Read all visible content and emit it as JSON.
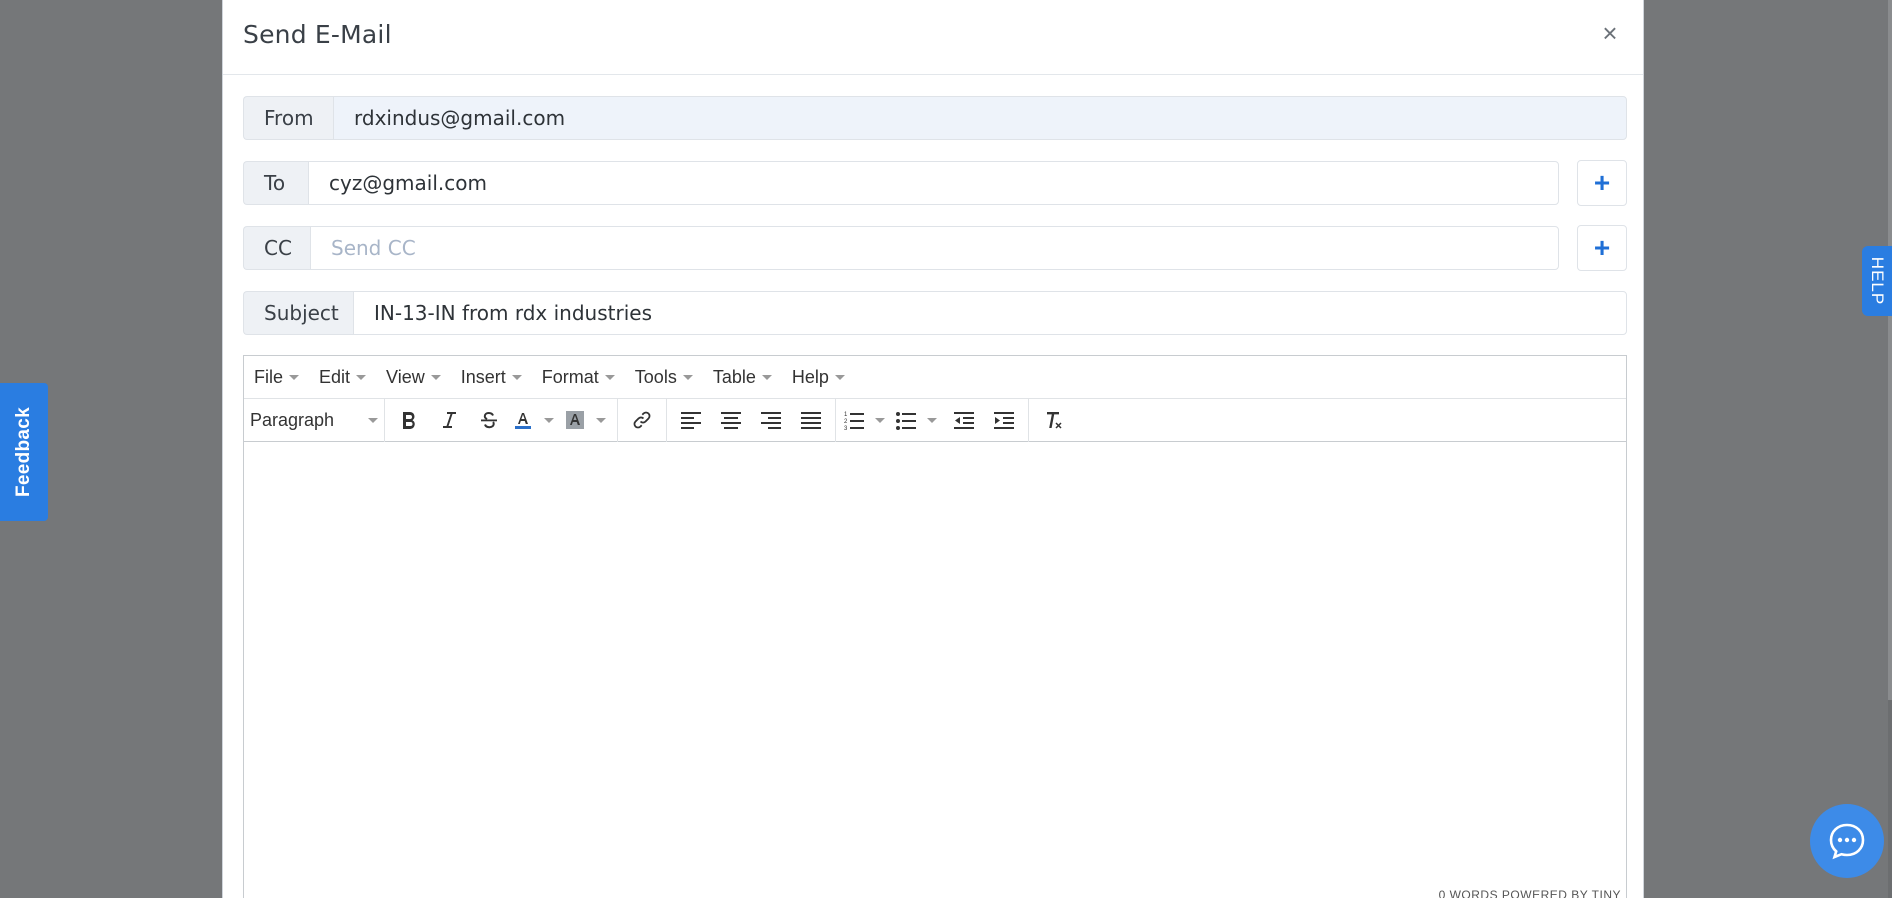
{
  "modal": {
    "title": "Send E-Mail",
    "close_label": "×"
  },
  "form": {
    "from": {
      "label": "From",
      "value": "rdxindus@gmail.com"
    },
    "to": {
      "label": "To",
      "value": "cyz@gmail.com",
      "add_label": "+"
    },
    "cc": {
      "label": "CC",
      "value": "",
      "placeholder": "Send CC",
      "add_label": "+"
    },
    "subject": {
      "label": "Subject",
      "value": "IN-13-IN from rdx industries"
    }
  },
  "editor": {
    "menus": [
      "File",
      "Edit",
      "View",
      "Insert",
      "Format",
      "Tools",
      "Table",
      "Help"
    ],
    "block_format": "Paragraph",
    "status": "0 WORDS POWERED BY TINY"
  },
  "side": {
    "feedback_label": "Feedback",
    "help_label": "HELP"
  },
  "colors": {
    "accent": "#2a7de1",
    "overlay": "#757779",
    "plus": "#1f6fd6"
  }
}
